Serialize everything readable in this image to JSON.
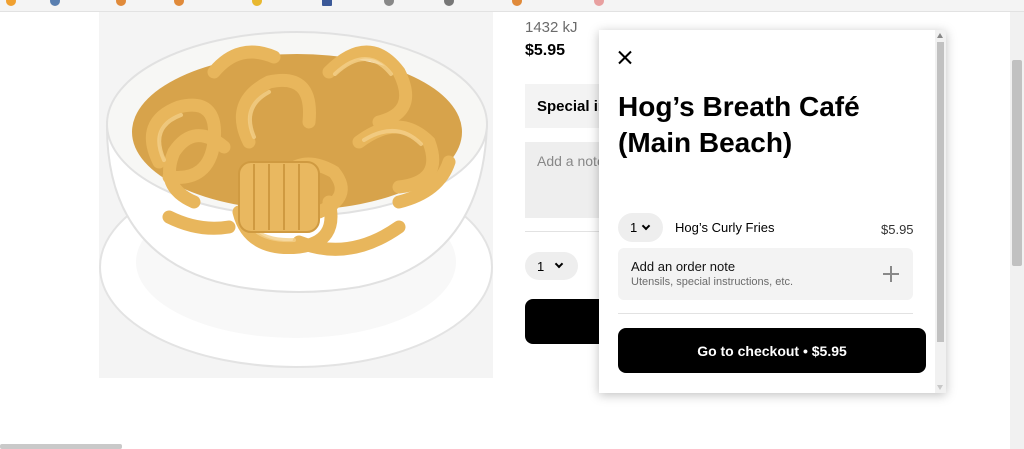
{
  "product": {
    "energy": "1432 kJ",
    "price": "$5.95",
    "special_instructions_label": "Special instructions",
    "note_placeholder": "Add a note",
    "quantity": "1"
  },
  "cart": {
    "store_name": "Hog’s Breath Café (Main Beach)",
    "item": {
      "quantity": "1",
      "name": "Hog’s Curly Fries",
      "price": "$5.95"
    },
    "order_note": {
      "title": "Add an order note",
      "subtitle": "Utensils, special instructions, etc."
    },
    "checkout_label": "Go to checkout • $5.95"
  },
  "icons": {
    "close": "close-icon",
    "chevron": "chevron-down-icon",
    "plus": "plus-icon"
  },
  "colors": {
    "accent": "#000000",
    "panel_bg": "#ffffff",
    "field_bg": "#f3f3f3",
    "muted_text": "#6b6b6b"
  }
}
